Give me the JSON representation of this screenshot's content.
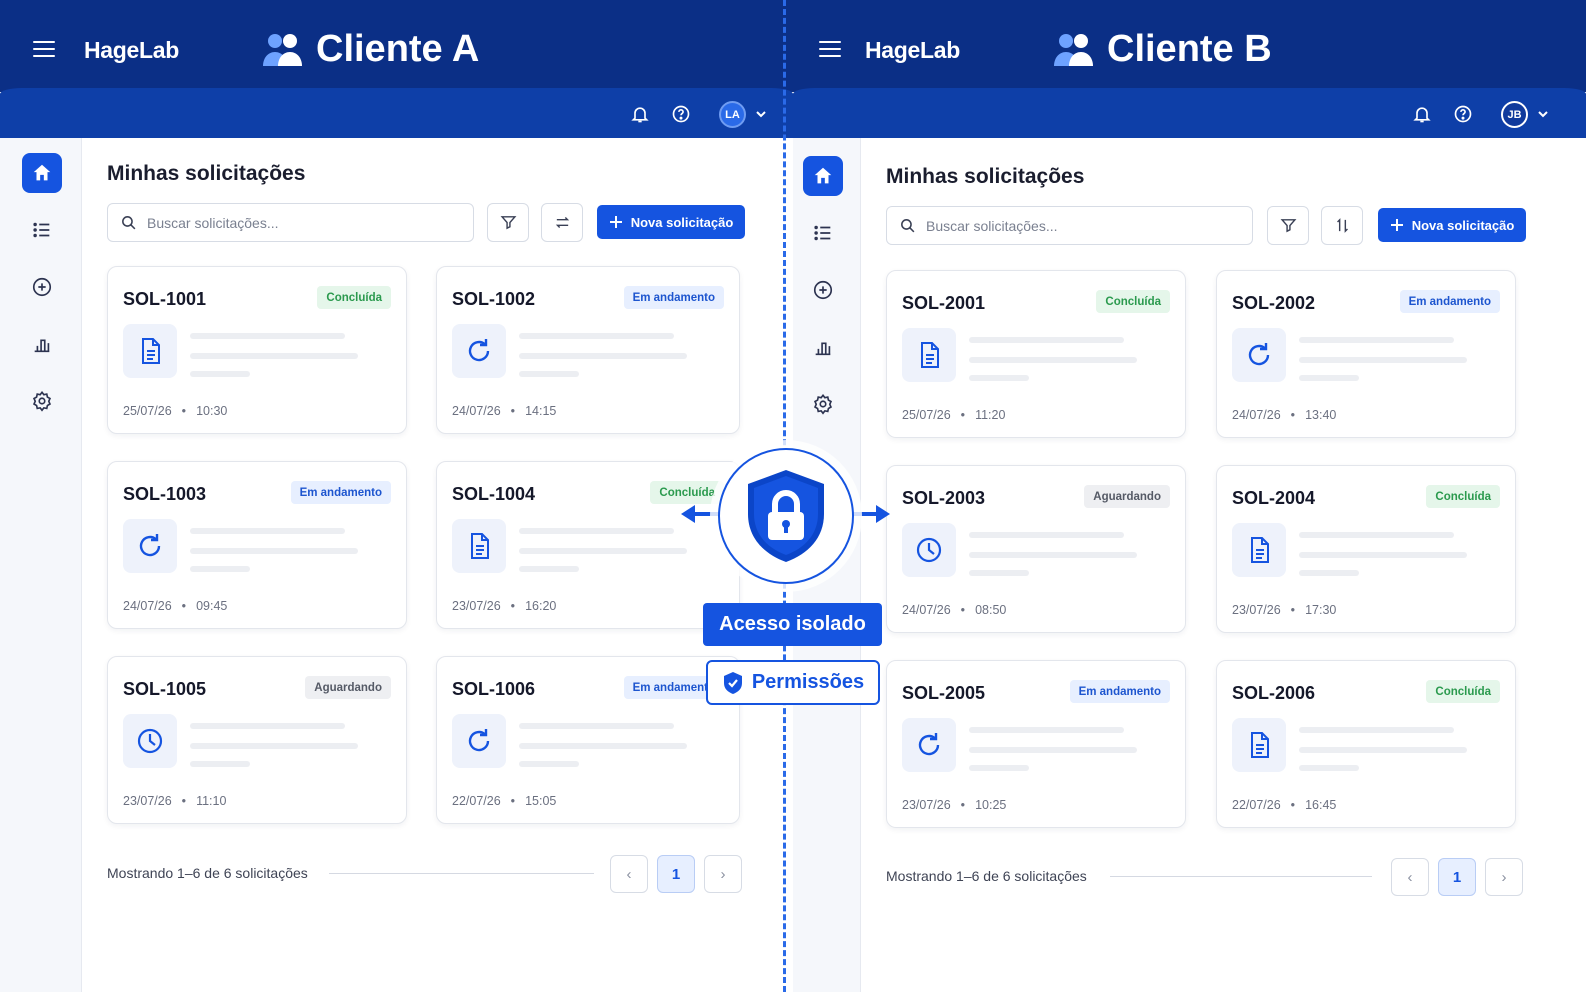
{
  "colors": {
    "brand_dark": "#0b2f86",
    "brand": "#0e3fa8",
    "accent": "#1554e0",
    "done": "#2b9a4e",
    "progress": "#1d55cf"
  },
  "panels": [
    {
      "brand": "HageLab",
      "client": "Cliente A",
      "avatar": "LA",
      "page_title": "Minhas solicitações",
      "search_placeholder": "Buscar solicitações...",
      "new_label": "Nova solicitação",
      "footer": "Mostrando 1–6 de 6 solicitações",
      "page": "1",
      "cards": [
        {
          "id": "SOL-1001",
          "status": "Concluída",
          "kind": "done",
          "icon": "document-icon",
          "date": "25/07/26",
          "time": "10:30"
        },
        {
          "id": "SOL-1002",
          "status": "Em andamento",
          "kind": "prog",
          "icon": "refresh-icon",
          "date": "24/07/26",
          "time": "14:15"
        },
        {
          "id": "SOL-1003",
          "status": "Em andamento",
          "kind": "prog",
          "icon": "refresh-icon",
          "date": "24/07/26",
          "time": "09:45"
        },
        {
          "id": "SOL-1004",
          "status": "Concluída",
          "kind": "done",
          "icon": "document-icon",
          "date": "23/07/26",
          "time": "16:20"
        },
        {
          "id": "SOL-1005",
          "status": "Aguardando",
          "kind": "wait",
          "icon": "clock-icon",
          "date": "23/07/26",
          "time": "11:10"
        },
        {
          "id": "SOL-1006",
          "status": "Em andamento",
          "kind": "prog",
          "icon": "refresh-icon",
          "date": "22/07/26",
          "time": "15:05"
        }
      ]
    },
    {
      "brand": "HageLab",
      "client": "Cliente B",
      "avatar": "JB",
      "page_title": "Minhas solicitações",
      "search_placeholder": "Buscar solicitações...",
      "new_label": "Nova solicitação",
      "footer": "Mostrando 1–6 de 6 solicitações",
      "page": "1",
      "cards": [
        {
          "id": "SOL-2001",
          "status": "Concluída",
          "kind": "done",
          "icon": "document-icon",
          "date": "25/07/26",
          "time": "11:20"
        },
        {
          "id": "SOL-2002",
          "status": "Em andamento",
          "kind": "prog",
          "icon": "refresh-icon",
          "date": "24/07/26",
          "time": "13:40"
        },
        {
          "id": "SOL-2003",
          "status": "Aguardando",
          "kind": "wait",
          "icon": "clock-icon",
          "date": "24/07/26",
          "time": "08:50"
        },
        {
          "id": "SOL-2004",
          "status": "Concluída",
          "kind": "done",
          "icon": "document-icon",
          "date": "23/07/26",
          "time": "17:30"
        },
        {
          "id": "SOL-2005",
          "status": "Em andamento",
          "kind": "prog",
          "icon": "refresh-icon",
          "date": "23/07/26",
          "time": "10:25"
        },
        {
          "id": "SOL-2006",
          "status": "Concluída",
          "kind": "done",
          "icon": "document-icon",
          "date": "22/07/26",
          "time": "16:45"
        }
      ]
    }
  ],
  "center": {
    "isolation_label": "Acesso isolado",
    "permissions_label": "Permissões"
  }
}
